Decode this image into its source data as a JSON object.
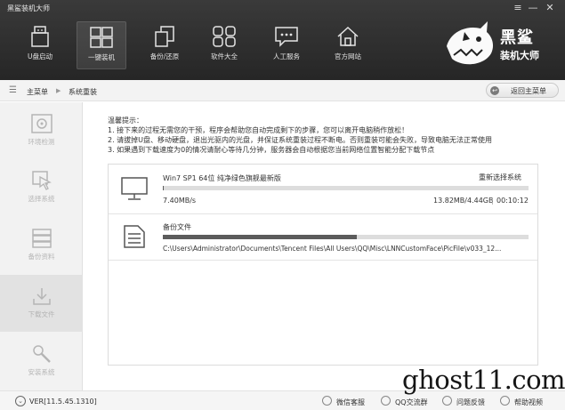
{
  "app": {
    "title": "黑鲨装机大师"
  },
  "window_controls": {
    "menu": "≡",
    "minimize": "—",
    "close": "✕"
  },
  "nav": [
    {
      "label": "U盘启动",
      "icon": "usb-icon"
    },
    {
      "label": "一键装机",
      "icon": "windows-icon",
      "active": true
    },
    {
      "label": "备份/还原",
      "icon": "backup-icon"
    },
    {
      "label": "软件大全",
      "icon": "apps-icon"
    },
    {
      "label": "人工服务",
      "icon": "chat-icon"
    },
    {
      "label": "官方网站",
      "icon": "home-icon"
    }
  ],
  "logo": {
    "line1": "黑鲨",
    "line2": "装机大师"
  },
  "breadcrumb": {
    "root": "主菜单",
    "current": "系统重装"
  },
  "back_button": {
    "label": "返回主菜单"
  },
  "sidebar": [
    {
      "label": "环境检测",
      "icon": "environment-check-icon"
    },
    {
      "label": "选择系统",
      "icon": "select-system-icon"
    },
    {
      "label": "备份资料",
      "icon": "backup-data-icon"
    },
    {
      "label": "下载文件",
      "icon": "download-icon",
      "active": true
    },
    {
      "label": "安装系统",
      "icon": "install-icon"
    }
  ],
  "tips": {
    "title": "温馨提示：",
    "lines": [
      "1. 接下来的过程无需您的干预，程序会帮助您自动完成剩下的步骤，您可以离开电脑稍作放松！",
      "2. 请拔掉U盘、移动硬盘，退出光驱内的光盘，并保证系统重装过程不断电。否则重装可能会失败，导致电脑无法正常使用",
      "3. 如果遇到下载速度为0的情况请耐心等待几分钟，服务器会自动根据您当前网络位置智能分配下载节点"
    ]
  },
  "download": {
    "name": "Win7 SP1 64位 纯净绿色旗舰最新版",
    "reselect": "重新选择系统",
    "speed": "7.40MB/s",
    "size": "13.82MB/4.44GB",
    "time": "00:10:12",
    "progress": 0.003
  },
  "backup": {
    "label": "备份文件",
    "path": "C:\\Users\\Administrator\\Documents\\Tencent Files\\All Users\\QQ\\Misc\\LNNCustomFace\\PicFile\\v033_12...",
    "progress": 0.53
  },
  "footer": {
    "version": "VER[11.5.45.1310]",
    "links": [
      "微信客服",
      "QQ交流群",
      "问题反馈",
      "帮助视频"
    ]
  },
  "watermark": "ghost11.com"
}
